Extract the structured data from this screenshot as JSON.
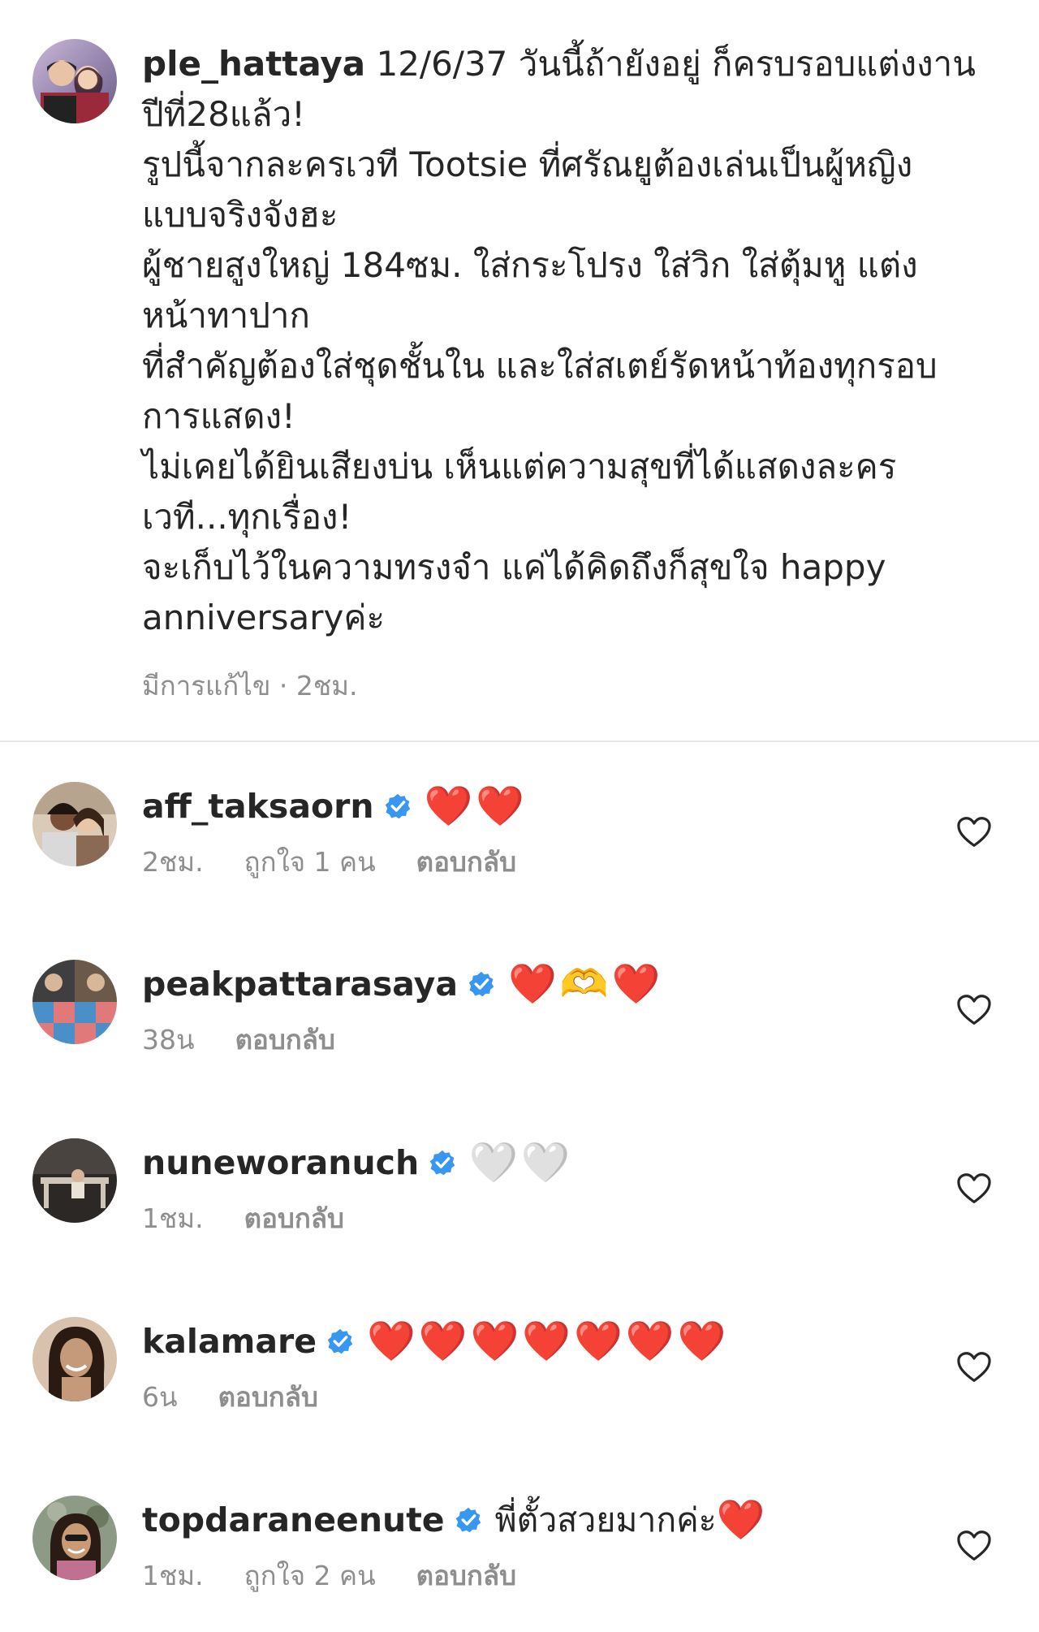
{
  "caption": {
    "username": "ple_hattaya",
    "first_line_text": " 12/6/37 วันนี้ถ้ายังอยู่ ก็ครบรอบแต่งงาน",
    "lines": [
      "ปีที่28แล้ว!",
      "รูปนี้จากละครเวที Tootsie ที่ศรัณยูต้องเล่นเป็นผู้หญิง",
      "แบบจริงจังฮะ",
      "ผู้ชายสูงใหญ่ 184ซม. ใส่กระโปรง ใส่วิก ใส่ตุ้มหู แต่ง",
      "หน้าทาปาก",
      "ที่สำคัญต้องใส่ชุดชั้นใน และใส่สเตย์รัดหน้าท้องทุกรอบ",
      "การแสดง!",
      "ไม่เคยได้ยินเสียงบ่น เห็นแต่ความสุขที่ได้แสดงละคร",
      "เวที...ทุกเรื่อง!",
      "จะเก็บไว้ในความทรงจำ แค่ได้คิดถึงก็สุขใจ happy",
      "anniversaryค่ะ"
    ],
    "meta": "มีการแก้ไข · 2ชม.",
    "avatar_icon": "avatar-couple-photo"
  },
  "comments": [
    {
      "username": "aff_taksaorn",
      "text": "",
      "emoji": "❤️❤️",
      "emoji_style": "red",
      "time": "2ชม.",
      "likes": "ถูกใจ 1 คน",
      "reply": "ตอบกลับ",
      "avatar_color": "#8a6a55"
    },
    {
      "username": "peakpattarasaya",
      "text": "",
      "emoji": "❤️🫶❤️",
      "emoji_style": "red",
      "time": "38น",
      "likes": "",
      "reply": "ตอบกลับ",
      "avatar_color": "#4b8fc9"
    },
    {
      "username": "nuneworanuch",
      "text": "",
      "emoji": "🤍🤍",
      "emoji_style": "white",
      "time": "1ชม.",
      "likes": "",
      "reply": "ตอบกลับ",
      "avatar_color": "#3a3430"
    },
    {
      "username": "kalamare",
      "text": "",
      "emoji": "❤️❤️❤️❤️❤️❤️❤️",
      "emoji_style": "red",
      "time": "6น",
      "likes": "",
      "reply": "ตอบกลับ",
      "avatar_color": "#c49a7a"
    },
    {
      "username": "topdaraneenute",
      "text": "พี่ตั้วสวยมากค่ะ",
      "emoji": "❤️",
      "emoji_style": "red",
      "time": "1ชม.",
      "likes": "ถูกใจ 2 คน",
      "reply": "ตอบกลับ",
      "avatar_color": "#6b7a60"
    }
  ],
  "icons": {
    "verified": "verified-badge-icon",
    "like": "heart-outline-icon"
  },
  "colors": {
    "verified_blue": "#3897f0",
    "meta_gray": "#8e8e8e",
    "heart_red": "#e0162b"
  }
}
